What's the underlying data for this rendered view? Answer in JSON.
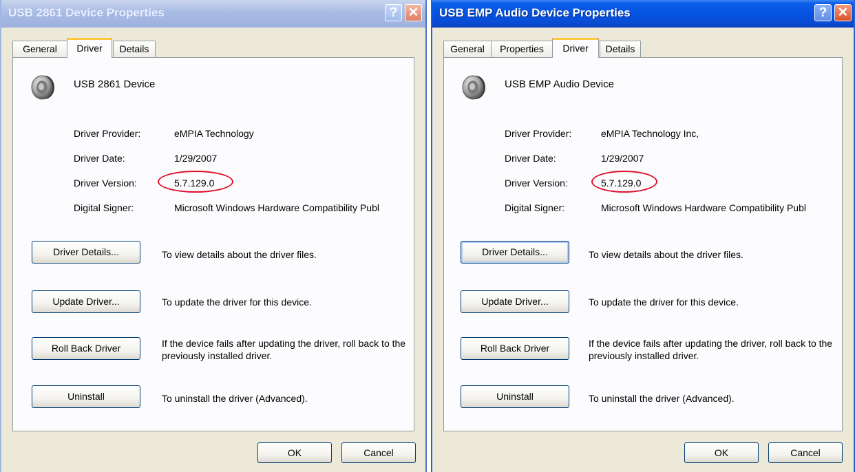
{
  "colors": {
    "ellipse": "#e0102a",
    "xp_blue": "#0551e0",
    "dialog_bg": "#ece9d8"
  },
  "windows": [
    {
      "title": "USB 2861 Device Properties",
      "help_label": "?",
      "close_label": "✕",
      "tabs": [
        "General",
        "Driver",
        "Details"
      ],
      "active_tab": "Driver",
      "device_name": "USB 2861 Device",
      "info": [
        {
          "label": "Driver Provider:",
          "value": "eMPIA Technology"
        },
        {
          "label": "Driver Date:",
          "value": "1/29/2007"
        },
        {
          "label": "Driver Version:",
          "value": "5.7.129.0"
        },
        {
          "label": "Digital Signer:",
          "value": "Microsoft Windows Hardware Compatibility Publ"
        }
      ],
      "actions": [
        {
          "button": "Driver Details...",
          "desc": "To view details about the driver files."
        },
        {
          "button": "Update Driver...",
          "desc": "To update the driver for this device."
        },
        {
          "button": "Roll Back Driver",
          "desc": "If the device fails after updating the driver, roll back to the previously installed driver."
        },
        {
          "button": "Uninstall",
          "desc": "To uninstall the driver (Advanced)."
        }
      ],
      "ok_label": "OK",
      "cancel_label": "Cancel"
    },
    {
      "title": "USB EMP Audio Device Properties",
      "help_label": "?",
      "close_label": "✕",
      "tabs": [
        "General",
        "Properties",
        "Driver",
        "Details"
      ],
      "active_tab": "Driver",
      "device_name": "USB EMP Audio Device",
      "info": [
        {
          "label": "Driver Provider:",
          "value": "eMPIA Technology Inc,"
        },
        {
          "label": "Driver Date:",
          "value": "1/29/2007"
        },
        {
          "label": "Driver Version:",
          "value": "5.7.129.0"
        },
        {
          "label": "Digital Signer:",
          "value": "Microsoft Windows Hardware Compatibility Publ"
        }
      ],
      "actions": [
        {
          "button": "Driver Details...",
          "desc": "To view details about the driver files."
        },
        {
          "button": "Update Driver...",
          "desc": "To update the driver for this device."
        },
        {
          "button": "Roll Back Driver",
          "desc": "If the device fails after updating the driver, roll back to the previously installed driver."
        },
        {
          "button": "Uninstall",
          "desc": "To uninstall the driver (Advanced)."
        }
      ],
      "ok_label": "OK",
      "cancel_label": "Cancel"
    }
  ]
}
